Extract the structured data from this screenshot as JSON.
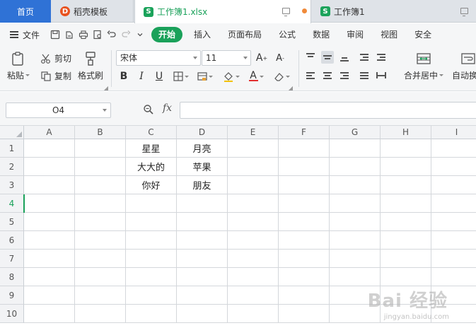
{
  "tabs": {
    "home": "首页",
    "docer": "稻壳模板",
    "active_file": "工作簿1.xlsx",
    "second_file": "工作簿1"
  },
  "menu": {
    "file": "文件",
    "items": [
      "开始",
      "插入",
      "页面布局",
      "公式",
      "数据",
      "审阅",
      "视图",
      "安全"
    ]
  },
  "ribbon": {
    "paste": "粘贴",
    "cut": "剪切",
    "copy": "复制",
    "format_painter": "格式刷",
    "font_name": "宋体",
    "font_size": "11",
    "merge_center": "合并居中",
    "auto_wrap": "自动换"
  },
  "formula_bar": {
    "name_box": "O4",
    "fx_label": "fx",
    "formula": ""
  },
  "grid": {
    "columns": [
      "A",
      "B",
      "C",
      "D",
      "E",
      "F",
      "G",
      "H",
      "I"
    ],
    "rows": [
      "1",
      "2",
      "3",
      "4",
      "5",
      "6",
      "7",
      "8",
      "9",
      "10"
    ],
    "cells": {
      "C1": "星星",
      "D1": "月亮",
      "C2": "大大的",
      "D2": "苹果",
      "C3": "你好",
      "D3": "朋友"
    },
    "active_row": "4"
  },
  "watermark": {
    "text": "Bai 经验",
    "sub": "jingyan.baidu.com"
  },
  "colors": {
    "accent_green": "#1aa15a",
    "home_tab_blue": "#2f72d6"
  }
}
